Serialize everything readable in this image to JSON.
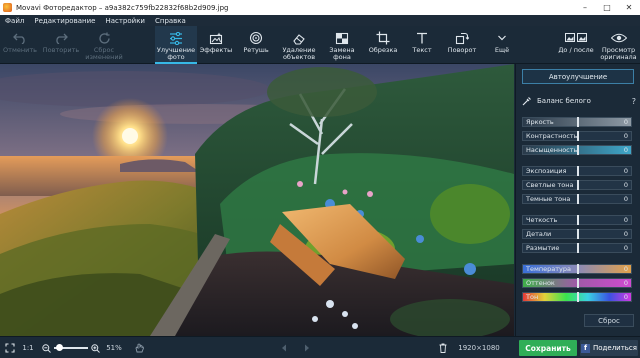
{
  "window": {
    "title": "Movavi Фоторедактор – a9a382c759fb22832f68b2d909.jpg"
  },
  "menu": {
    "items": [
      "Файл",
      "Редактирование",
      "Настройки",
      "Справка"
    ]
  },
  "toolbar": {
    "undo": "Отменить",
    "redo": "Повторить",
    "reset_line1": "Сброс",
    "reset_line2": "изменений",
    "enhance_line1": "Улучшение",
    "enhance_line2": "фото",
    "effects": "Эффекты",
    "retouch": "Ретушь",
    "remove_line1": "Удаление",
    "remove_line2": "объектов",
    "bg_line1": "Замена",
    "bg_line2": "фона",
    "crop": "Обрезка",
    "text": "Текст",
    "rotate": "Поворот",
    "more": "Ещё",
    "before_after": "До / после",
    "preview_line1": "Просмотр",
    "preview_line2": "оригинала"
  },
  "panel": {
    "auto_button": "Автоулучшение",
    "white_balance": "Баланс белого",
    "help": "?",
    "reset_button": "Сброс",
    "sliders": [
      {
        "label": "Яркость",
        "value": "0",
        "level": 0.5,
        "style": "brightness"
      },
      {
        "label": "Контрастность",
        "value": "0",
        "level": 0.5,
        "style": "plain"
      },
      {
        "label": "Насыщенность",
        "value": "0",
        "level": 0.5,
        "style": "saturation"
      },
      {
        "label": "Экспозиция",
        "value": "0",
        "level": 0.5,
        "style": "plain"
      },
      {
        "label": "Светлые тона",
        "value": "0",
        "level": 0.5,
        "style": "plain"
      },
      {
        "label": "Темные тона",
        "value": "0",
        "level": 0.5,
        "style": "plain"
      },
      {
        "label": "Четкость",
        "value": "0",
        "level": 0.5,
        "style": "plain"
      },
      {
        "label": "Детали",
        "value": "0",
        "level": 0.5,
        "style": "plain"
      },
      {
        "label": "Размытие",
        "value": "0",
        "level": 0.5,
        "style": "plain"
      },
      {
        "label": "Температура",
        "value": "0",
        "level": 0.5,
        "style": "temperature"
      },
      {
        "label": "Оттенок",
        "value": "0",
        "level": 0.5,
        "style": "tint"
      },
      {
        "label": "Тон",
        "value": "0",
        "level": 0.5,
        "style": "hue"
      }
    ]
  },
  "statusbar": {
    "ratio": "1:1",
    "zoom": "51%",
    "dimensions": "1920×1080",
    "save": "Сохранить",
    "share": "Поделиться"
  },
  "colors": {
    "accent": "#37b8e6",
    "save_green": "#2fae57",
    "background": "#1b2a38"
  }
}
